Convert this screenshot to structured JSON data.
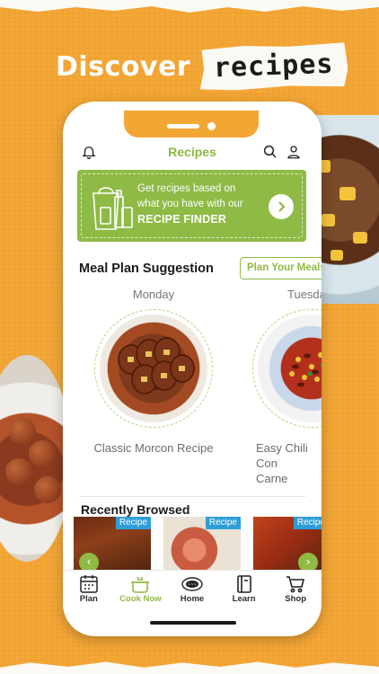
{
  "headline": {
    "discover": "Discover",
    "recipes": "recipes"
  },
  "app": {
    "title": "Recipes",
    "banner": {
      "line1": "Get recipes based on",
      "line2": "what you have with our",
      "line3": "RECIPE FINDER"
    },
    "meal_plan": {
      "title": "Meal Plan Suggestion",
      "plan_button": "Plan Your Meals",
      "days": [
        {
          "day": "Monday",
          "recipe": "Classic Morcon Recipe"
        },
        {
          "day": "Tuesday",
          "recipe": "Easy Chili Con Carne"
        }
      ]
    },
    "recent": {
      "title": "Recently Browsed",
      "tag": "Recipe"
    },
    "tabs": [
      {
        "label": "Plan",
        "icon": "calendar-icon"
      },
      {
        "label": "Cook Now",
        "icon": "pot-icon"
      },
      {
        "label": "Home",
        "icon": "brand-logo-icon"
      },
      {
        "label": "Learn",
        "icon": "book-icon"
      },
      {
        "label": "Shop",
        "icon": "cart-icon"
      }
    ]
  },
  "colors": {
    "background": "#f3a533",
    "accent_green": "#8fba45",
    "tag_blue": "#2f9ed8"
  }
}
